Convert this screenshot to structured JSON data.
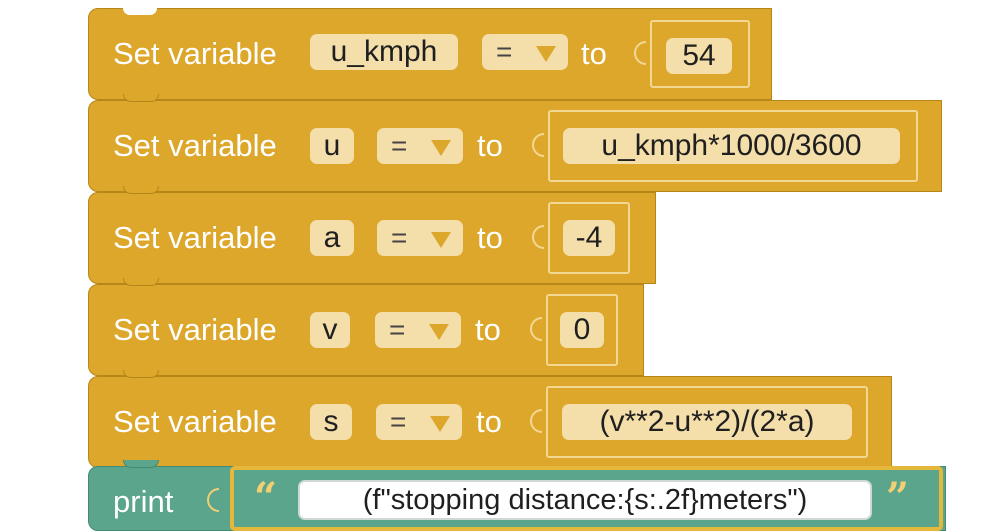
{
  "blocks": [
    {
      "keyword": "Set variable",
      "name": "u_kmph",
      "op": "=",
      "to": "to",
      "value": "54"
    },
    {
      "keyword": "Set variable",
      "name": "u",
      "op": "=",
      "to": "to",
      "value": "u_kmph*1000/3600"
    },
    {
      "keyword": "Set variable",
      "name": "a",
      "op": "=",
      "to": "to",
      "value": "-4"
    },
    {
      "keyword": "Set variable",
      "name": "v",
      "op": "=",
      "to": "to",
      "value": "0"
    },
    {
      "keyword": "Set variable",
      "name": "s",
      "op": "=",
      "to": "to",
      "value": "(v**2-u**2)/(2*a)"
    }
  ],
  "print_block": {
    "keyword": "print",
    "open_quote": "“",
    "text": "(f\"stopping distance:{s:.2f}meters\")",
    "close_quote": "”"
  },
  "colors": {
    "variable_block": "#dca72a",
    "print_block": "#5ba58c",
    "field": "#f4deaa"
  },
  "icons": {
    "dropdown": "triangle-down-icon",
    "quote": "quote-icon"
  }
}
